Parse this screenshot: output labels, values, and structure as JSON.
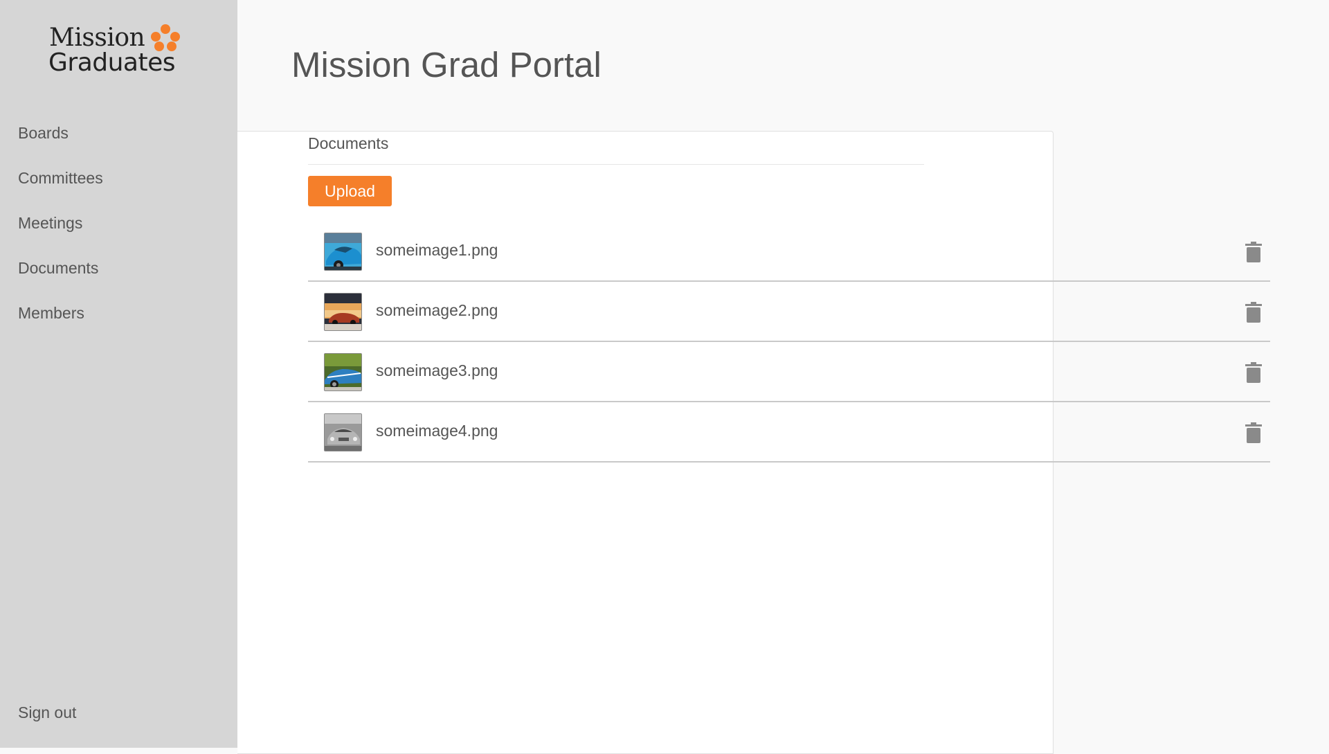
{
  "app": {
    "logo_line1": "Mission",
    "logo_line2": "Graduates",
    "title": "Mission Grad Portal",
    "accent_color": "#f57f2a"
  },
  "sidebar": {
    "items": [
      {
        "label": "Boards"
      },
      {
        "label": "Committees"
      },
      {
        "label": "Meetings"
      },
      {
        "label": "Documents"
      },
      {
        "label": "Members"
      }
    ],
    "signout_label": "Sign out"
  },
  "documents": {
    "section_title": "Documents",
    "upload_label": "Upload",
    "files": [
      {
        "name": "someimage1.png",
        "thumb": "blue-car-thumbnail",
        "action_icon": "trash-icon"
      },
      {
        "name": "someimage2.png",
        "thumb": "sunset-car-thumbnail",
        "action_icon": "trash-icon"
      },
      {
        "name": "someimage3.png",
        "thumb": "blue-racing-car-thumbnail",
        "action_icon": "trash-icon"
      },
      {
        "name": "someimage4.png",
        "thumb": "silver-car-thumbnail",
        "action_icon": "trash-icon"
      }
    ]
  }
}
